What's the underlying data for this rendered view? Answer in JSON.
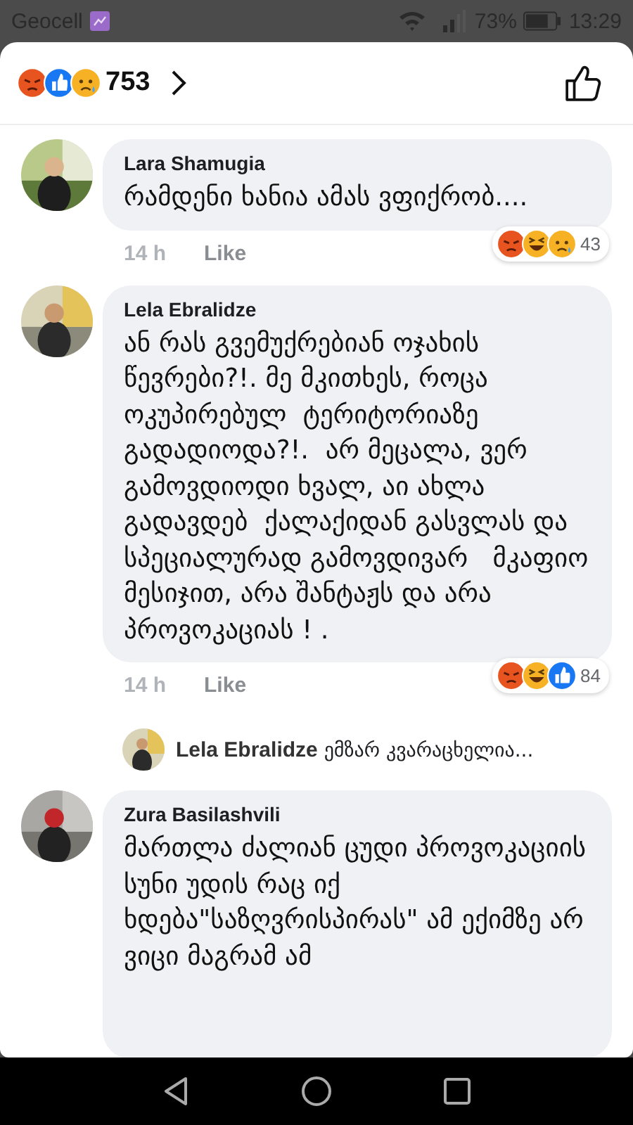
{
  "status_bar": {
    "carrier": "Geocell",
    "battery": "73%",
    "time": "13:29"
  },
  "header": {
    "reactions": [
      {
        "kind": "angry"
      },
      {
        "kind": "like"
      },
      {
        "kind": "sad"
      }
    ],
    "count": "753"
  },
  "comments": [
    {
      "author": "Lara Shamugia",
      "text": "რამდენი ხანია ამას ვფიქრობ....",
      "time": "14 h",
      "like": "Like",
      "reactions": [
        {
          "kind": "angry"
        },
        {
          "kind": "haha"
        },
        {
          "kind": "sad"
        }
      ],
      "reaction_count": "43"
    },
    {
      "author": "Lela Ebralidze",
      "text": "ან რას გვემუქრებიან ოჯახის წევრები?!. მე მკითხეს, როცა ოკუპირებულ  ტერიტორიაზე გადადიოდა?!.  არ მეცალა, ვერ გამოვდიოდი ხვალ, აი ახლა გადავდებ  ქალაქიდან გასვლას და სპეციალურად გამოვდივარ   მკაფიო მესიჯით, არა შანტაჟს და არა პროვოკაციას ! .",
      "time": "14 h",
      "like": "Like",
      "reactions": [
        {
          "kind": "angry"
        },
        {
          "kind": "haha"
        },
        {
          "kind": "like"
        }
      ],
      "reaction_count": "84",
      "reply": {
        "author": "Lela Ebralidze",
        "text": "ემზარ კვარაცხელია..."
      }
    },
    {
      "author": "Zura Basilashvili",
      "text": "მართლა ძალიან ცუდი პროვოკაციის სუნი უდის რაც იქ ხდება\"საზღვრისპირას\" ამ ექიმზე არ ვიცი მაგრამ ამ"
    }
  ]
}
